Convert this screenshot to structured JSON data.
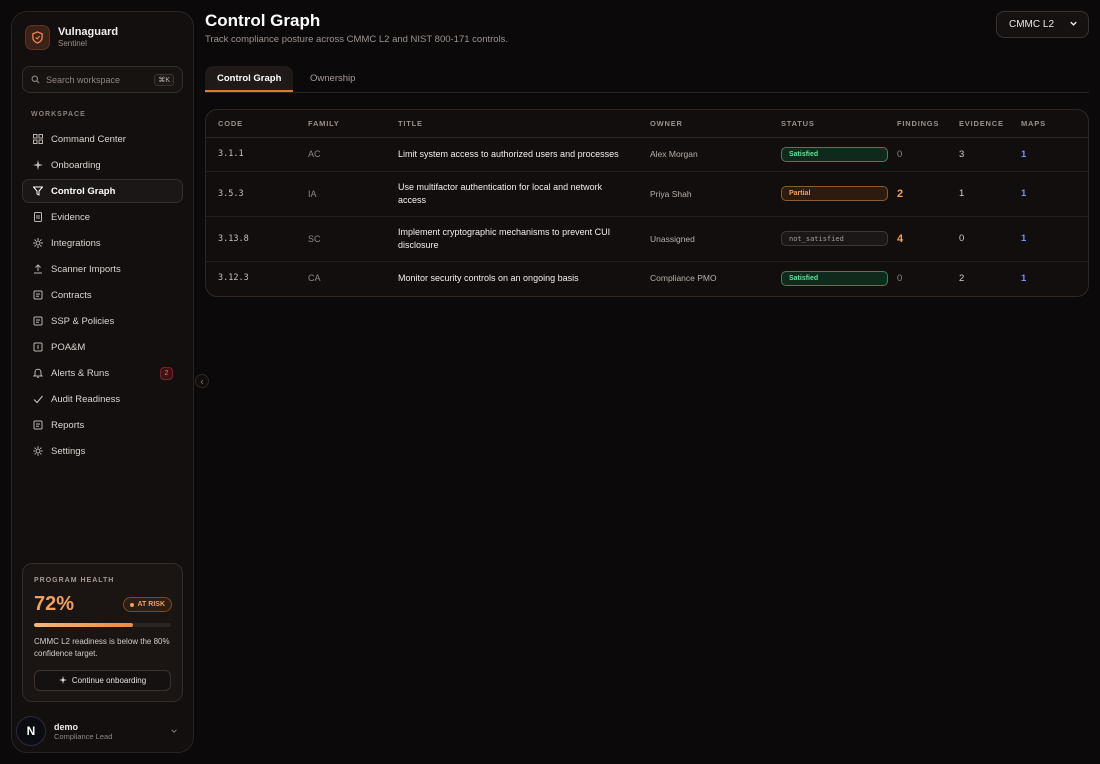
{
  "brand": {
    "name": "Vulnaguard",
    "subtitle": "Sentinel"
  },
  "search": {
    "placeholder": "Search workspace",
    "shortcut": "⌘K"
  },
  "sidebar": {
    "section_label": "WORKSPACE",
    "items": [
      {
        "label": "Command Center",
        "icon": "grid-icon"
      },
      {
        "label": "Onboarding",
        "icon": "sparkle-icon"
      },
      {
        "label": "Control Graph",
        "icon": "filter-icon",
        "active": true
      },
      {
        "label": "Evidence",
        "icon": "document-icon"
      },
      {
        "label": "Integrations",
        "icon": "sun-icon"
      },
      {
        "label": "Scanner Imports",
        "icon": "upload-icon"
      },
      {
        "label": "Contracts",
        "icon": "file-icon"
      },
      {
        "label": "SSP & Policies",
        "icon": "file-icon"
      },
      {
        "label": "POA&M",
        "icon": "file-icon"
      },
      {
        "label": "Alerts & Runs",
        "icon": "bell-icon",
        "badge": "2"
      },
      {
        "label": "Audit Readiness",
        "icon": "check-icon"
      },
      {
        "label": "Reports",
        "icon": "file-icon"
      },
      {
        "label": "Settings",
        "icon": "gear-icon"
      }
    ]
  },
  "health": {
    "label": "PROGRAM HEALTH",
    "value": "72%",
    "progress": 0.72,
    "status": "AT RISK",
    "note": "CMMC L2 readiness is below the 80% confidence target.",
    "cta": "Continue onboarding"
  },
  "user": {
    "name": "demo",
    "role": "Compliance Lead",
    "avatar_letter": "N"
  },
  "header": {
    "title": "Control Graph",
    "subtitle": "Track compliance posture across CMMC L2 and NIST 800-171 controls.",
    "framework": "CMMC L2"
  },
  "tabs": [
    {
      "label": "Control Graph",
      "active": true
    },
    {
      "label": "Ownership",
      "active": false
    }
  ],
  "table": {
    "columns": [
      "CODE",
      "FAMILY",
      "TITLE",
      "OWNER",
      "STATUS",
      "FINDINGS",
      "EVIDENCE",
      "MAPS"
    ],
    "rows": [
      {
        "code": "3.1.1",
        "family": "AC",
        "title": "Limit system access to authorized users and processes",
        "owner": "Alex Morgan",
        "status": "Satisfied",
        "findings": "0",
        "evidence": "3",
        "maps": "1"
      },
      {
        "code": "3.5.3",
        "family": "IA",
        "title": "Use multifactor authentication for local and network access",
        "owner": "Priya Shah",
        "status": "Partial",
        "findings": "2",
        "evidence": "1",
        "maps": "1"
      },
      {
        "code": "3.13.8",
        "family": "SC",
        "title": "Implement cryptographic mechanisms to prevent CUI disclosure",
        "owner": "Unassigned",
        "status": "not_satisfied",
        "findings": "4",
        "evidence": "0",
        "maps": "1"
      },
      {
        "code": "3.12.3",
        "family": "CA",
        "title": "Monitor security controls on an ongoing basis",
        "owner": "Compliance PMO",
        "status": "Satisfied",
        "findings": "0",
        "evidence": "2",
        "maps": "1"
      }
    ]
  },
  "colors": {
    "accent": "#e88a4a",
    "success": "#5ee29a",
    "link": "#7b8cff",
    "danger": "#ff6b6b"
  }
}
